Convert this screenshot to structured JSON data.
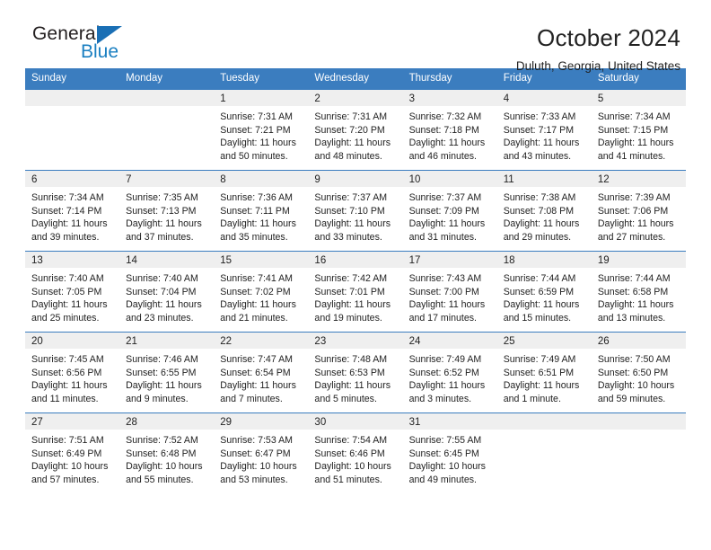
{
  "logo": {
    "word_one": "General",
    "word_two": "Blue",
    "triangle_color": "#1a6fb5",
    "blue_color": "#1a7fc1"
  },
  "header": {
    "title": "October 2024",
    "subtitle": "Duluth, Georgia, United States"
  },
  "colors": {
    "header_blue": "#3b7dbf",
    "daynum_band": "#efefef",
    "text": "#222222"
  },
  "calendar": {
    "weekday_headers": [
      "Sunday",
      "Monday",
      "Tuesday",
      "Wednesday",
      "Thursday",
      "Friday",
      "Saturday"
    ],
    "weeks": [
      [
        {
          "day": "",
          "sunrise": "",
          "sunset": "",
          "daylight_line1": "",
          "daylight_line2": ""
        },
        {
          "day": "",
          "sunrise": "",
          "sunset": "",
          "daylight_line1": "",
          "daylight_line2": ""
        },
        {
          "day": "1",
          "sunrise": "Sunrise: 7:31 AM",
          "sunset": "Sunset: 7:21 PM",
          "daylight_line1": "Daylight: 11 hours",
          "daylight_line2": "and 50 minutes."
        },
        {
          "day": "2",
          "sunrise": "Sunrise: 7:31 AM",
          "sunset": "Sunset: 7:20 PM",
          "daylight_line1": "Daylight: 11 hours",
          "daylight_line2": "and 48 minutes."
        },
        {
          "day": "3",
          "sunrise": "Sunrise: 7:32 AM",
          "sunset": "Sunset: 7:18 PM",
          "daylight_line1": "Daylight: 11 hours",
          "daylight_line2": "and 46 minutes."
        },
        {
          "day": "4",
          "sunrise": "Sunrise: 7:33 AM",
          "sunset": "Sunset: 7:17 PM",
          "daylight_line1": "Daylight: 11 hours",
          "daylight_line2": "and 43 minutes."
        },
        {
          "day": "5",
          "sunrise": "Sunrise: 7:34 AM",
          "sunset": "Sunset: 7:15 PM",
          "daylight_line1": "Daylight: 11 hours",
          "daylight_line2": "and 41 minutes."
        }
      ],
      [
        {
          "day": "6",
          "sunrise": "Sunrise: 7:34 AM",
          "sunset": "Sunset: 7:14 PM",
          "daylight_line1": "Daylight: 11 hours",
          "daylight_line2": "and 39 minutes."
        },
        {
          "day": "7",
          "sunrise": "Sunrise: 7:35 AM",
          "sunset": "Sunset: 7:13 PM",
          "daylight_line1": "Daylight: 11 hours",
          "daylight_line2": "and 37 minutes."
        },
        {
          "day": "8",
          "sunrise": "Sunrise: 7:36 AM",
          "sunset": "Sunset: 7:11 PM",
          "daylight_line1": "Daylight: 11 hours",
          "daylight_line2": "and 35 minutes."
        },
        {
          "day": "9",
          "sunrise": "Sunrise: 7:37 AM",
          "sunset": "Sunset: 7:10 PM",
          "daylight_line1": "Daylight: 11 hours",
          "daylight_line2": "and 33 minutes."
        },
        {
          "day": "10",
          "sunrise": "Sunrise: 7:37 AM",
          "sunset": "Sunset: 7:09 PM",
          "daylight_line1": "Daylight: 11 hours",
          "daylight_line2": "and 31 minutes."
        },
        {
          "day": "11",
          "sunrise": "Sunrise: 7:38 AM",
          "sunset": "Sunset: 7:08 PM",
          "daylight_line1": "Daylight: 11 hours",
          "daylight_line2": "and 29 minutes."
        },
        {
          "day": "12",
          "sunrise": "Sunrise: 7:39 AM",
          "sunset": "Sunset: 7:06 PM",
          "daylight_line1": "Daylight: 11 hours",
          "daylight_line2": "and 27 minutes."
        }
      ],
      [
        {
          "day": "13",
          "sunrise": "Sunrise: 7:40 AM",
          "sunset": "Sunset: 7:05 PM",
          "daylight_line1": "Daylight: 11 hours",
          "daylight_line2": "and 25 minutes."
        },
        {
          "day": "14",
          "sunrise": "Sunrise: 7:40 AM",
          "sunset": "Sunset: 7:04 PM",
          "daylight_line1": "Daylight: 11 hours",
          "daylight_line2": "and 23 minutes."
        },
        {
          "day": "15",
          "sunrise": "Sunrise: 7:41 AM",
          "sunset": "Sunset: 7:02 PM",
          "daylight_line1": "Daylight: 11 hours",
          "daylight_line2": "and 21 minutes."
        },
        {
          "day": "16",
          "sunrise": "Sunrise: 7:42 AM",
          "sunset": "Sunset: 7:01 PM",
          "daylight_line1": "Daylight: 11 hours",
          "daylight_line2": "and 19 minutes."
        },
        {
          "day": "17",
          "sunrise": "Sunrise: 7:43 AM",
          "sunset": "Sunset: 7:00 PM",
          "daylight_line1": "Daylight: 11 hours",
          "daylight_line2": "and 17 minutes."
        },
        {
          "day": "18",
          "sunrise": "Sunrise: 7:44 AM",
          "sunset": "Sunset: 6:59 PM",
          "daylight_line1": "Daylight: 11 hours",
          "daylight_line2": "and 15 minutes."
        },
        {
          "day": "19",
          "sunrise": "Sunrise: 7:44 AM",
          "sunset": "Sunset: 6:58 PM",
          "daylight_line1": "Daylight: 11 hours",
          "daylight_line2": "and 13 minutes."
        }
      ],
      [
        {
          "day": "20",
          "sunrise": "Sunrise: 7:45 AM",
          "sunset": "Sunset: 6:56 PM",
          "daylight_line1": "Daylight: 11 hours",
          "daylight_line2": "and 11 minutes."
        },
        {
          "day": "21",
          "sunrise": "Sunrise: 7:46 AM",
          "sunset": "Sunset: 6:55 PM",
          "daylight_line1": "Daylight: 11 hours",
          "daylight_line2": "and 9 minutes."
        },
        {
          "day": "22",
          "sunrise": "Sunrise: 7:47 AM",
          "sunset": "Sunset: 6:54 PM",
          "daylight_line1": "Daylight: 11 hours",
          "daylight_line2": "and 7 minutes."
        },
        {
          "day": "23",
          "sunrise": "Sunrise: 7:48 AM",
          "sunset": "Sunset: 6:53 PM",
          "daylight_line1": "Daylight: 11 hours",
          "daylight_line2": "and 5 minutes."
        },
        {
          "day": "24",
          "sunrise": "Sunrise: 7:49 AM",
          "sunset": "Sunset: 6:52 PM",
          "daylight_line1": "Daylight: 11 hours",
          "daylight_line2": "and 3 minutes."
        },
        {
          "day": "25",
          "sunrise": "Sunrise: 7:49 AM",
          "sunset": "Sunset: 6:51 PM",
          "daylight_line1": "Daylight: 11 hours",
          "daylight_line2": "and 1 minute."
        },
        {
          "day": "26",
          "sunrise": "Sunrise: 7:50 AM",
          "sunset": "Sunset: 6:50 PM",
          "daylight_line1": "Daylight: 10 hours",
          "daylight_line2": "and 59 minutes."
        }
      ],
      [
        {
          "day": "27",
          "sunrise": "Sunrise: 7:51 AM",
          "sunset": "Sunset: 6:49 PM",
          "daylight_line1": "Daylight: 10 hours",
          "daylight_line2": "and 57 minutes."
        },
        {
          "day": "28",
          "sunrise": "Sunrise: 7:52 AM",
          "sunset": "Sunset: 6:48 PM",
          "daylight_line1": "Daylight: 10 hours",
          "daylight_line2": "and 55 minutes."
        },
        {
          "day": "29",
          "sunrise": "Sunrise: 7:53 AM",
          "sunset": "Sunset: 6:47 PM",
          "daylight_line1": "Daylight: 10 hours",
          "daylight_line2": "and 53 minutes."
        },
        {
          "day": "30",
          "sunrise": "Sunrise: 7:54 AM",
          "sunset": "Sunset: 6:46 PM",
          "daylight_line1": "Daylight: 10 hours",
          "daylight_line2": "and 51 minutes."
        },
        {
          "day": "31",
          "sunrise": "Sunrise: 7:55 AM",
          "sunset": "Sunset: 6:45 PM",
          "daylight_line1": "Daylight: 10 hours",
          "daylight_line2": "and 49 minutes."
        },
        {
          "day": "",
          "sunrise": "",
          "sunset": "",
          "daylight_line1": "",
          "daylight_line2": ""
        },
        {
          "day": "",
          "sunrise": "",
          "sunset": "",
          "daylight_line1": "",
          "daylight_line2": ""
        }
      ]
    ]
  }
}
